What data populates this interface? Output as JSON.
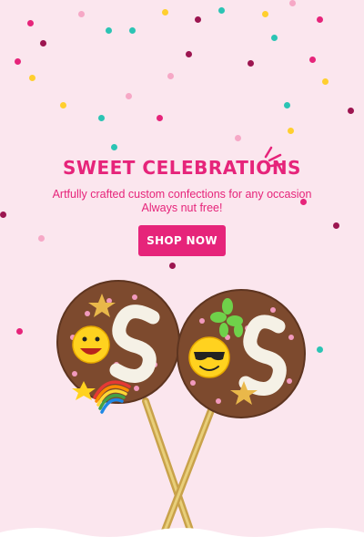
{
  "hero": {
    "headline": "SWEET CELEBRATIONS",
    "subtitle_line1": "Artfully crafted custom confections for any occasion",
    "subtitle_line2": "Always nut free!",
    "cta_label": "SHOP NOW"
  },
  "colors": {
    "brand": "#e6247a",
    "background": "#fbe6ee",
    "chocolate": "#7d4a2e",
    "white": "#ffffff"
  },
  "icons": [
    "sparkle-icon",
    "confetti"
  ],
  "image": {
    "subject": "two chocolate lollipops shaped as the letter S"
  }
}
